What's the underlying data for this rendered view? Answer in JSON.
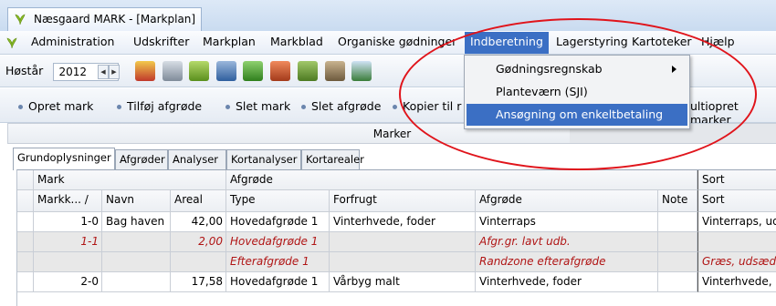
{
  "window": {
    "title": "Næsgaard MARK - [Markplan]"
  },
  "menu": {
    "items": [
      "Administration",
      "Udskrifter",
      "Markplan",
      "Markblad",
      "Organiske gødninger",
      "Indberetning",
      "Lagerstyring",
      "Kartoteker",
      "Hjælp"
    ],
    "active": "Indberetning"
  },
  "dropdown": {
    "items": [
      {
        "label": "Gødningsregnskab",
        "submenu": true
      },
      {
        "label": "Planteværn (SJI)",
        "submenu": false
      },
      {
        "label": "Ansøgning om enkeltbetaling",
        "submenu": false,
        "highlighted": true
      }
    ]
  },
  "toolbar": {
    "year_label": "Høstår",
    "year_value": "2012"
  },
  "actions": [
    "Opret mark",
    "Tilføj afgrøde",
    "Slet mark",
    "Slet afgrøde",
    "Kopier til r",
    "ultiopret marker"
  ],
  "panel": {
    "title": "Marker"
  },
  "tabs": [
    "Grundoplysninger",
    "Afgrøder",
    "Analyser",
    "Kortanalyser",
    "Kortarealer"
  ],
  "grid": {
    "group_headers": [
      "Mark",
      "Afgrøde",
      "Sort"
    ],
    "columns": [
      "Markk... /",
      "Navn",
      "Areal",
      "Type",
      "Forfrugt",
      "Afgrøde",
      "Note",
      "Sort"
    ],
    "rows": [
      {
        "nr": "1-0",
        "navn": "Bag haven",
        "areal": "42,00",
        "type": "Hovedafgrøde 1",
        "forfrugt": "Vinterhvede, foder",
        "afgrode": "Vinterraps",
        "note": "",
        "sort": "Vinterraps, udsæd",
        "style": "normal"
      },
      {
        "nr": "1-1",
        "navn": "",
        "areal": "2,00",
        "type": "Hovedafgrøde 1",
        "forfrugt": "",
        "afgrode": "Afgr.gr. lavt udb.",
        "note": "",
        "sort": "",
        "style": "red"
      },
      {
        "nr": "",
        "navn": "",
        "areal": "",
        "type": "Efterafgrøde 1",
        "forfrugt": "",
        "afgrode": "Randzone efterafgrøde",
        "note": "",
        "sort": "Græs, udsæd",
        "style": "red"
      },
      {
        "nr": "2-0",
        "navn": "",
        "areal": "17,58",
        "type": "Hovedafgrøde 1",
        "forfrugt": "Vårbyg malt",
        "afgrode": "Vinterhvede, foder",
        "note": "",
        "sort": "Vinterhvede, udsæd",
        "style": "normal"
      }
    ]
  },
  "colors": {
    "menu_highlight": "#3b6fc4",
    "annotation_ellipse": "#e0141b",
    "red_text": "#b01515"
  }
}
